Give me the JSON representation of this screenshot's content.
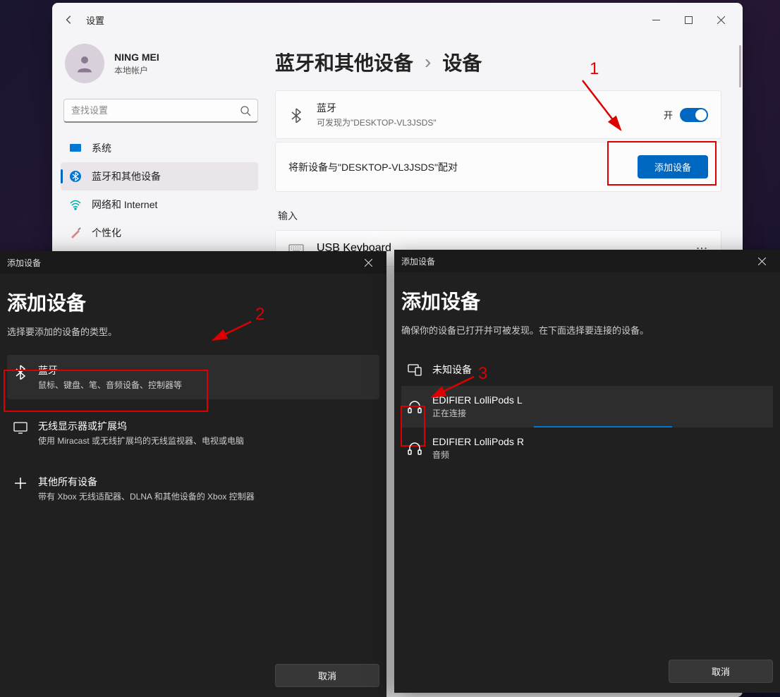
{
  "window": {
    "title": "设置",
    "profile_name": "NING MEI",
    "profile_sub": "本地帐户",
    "search_placeholder": "查找设置"
  },
  "nav": {
    "system": "系统",
    "bluetooth": "蓝牙和其他设备",
    "network": "网络和 Internet",
    "personalization": "个性化"
  },
  "breadcrumb": {
    "parent": "蓝牙和其他设备",
    "current": "设备"
  },
  "bluetooth_card": {
    "title": "蓝牙",
    "sub": "可发现为\"DESKTOP-VL3JSDS\"",
    "toggle_label": "开"
  },
  "pair_card": {
    "text": "将新设备与\"DESKTOP-VL3JSDS\"配对",
    "button": "添加设备"
  },
  "input_section": {
    "label": "输入",
    "device1": "USB Keyboard"
  },
  "annotations": {
    "num1": "1",
    "num2": "2",
    "num3": "3"
  },
  "dialog1": {
    "titlebar": "添加设备",
    "heading": "添加设备",
    "sub": "选择要添加的设备的类型。",
    "opt_bt_title": "蓝牙",
    "opt_bt_sub": "鼠标、键盘、笔、音频设备、控制器等",
    "opt_wd_title": "无线显示器或扩展坞",
    "opt_wd_sub": "使用 Miracast 或无线扩展坞的无线监视器、电视或电脑",
    "opt_other_title": "其他所有设备",
    "opt_other_sub": "带有 Xbox 无线适配器、DLNA 和其他设备的 Xbox 控制器",
    "cancel": "取消"
  },
  "dialog2": {
    "titlebar": "添加设备",
    "heading": "添加设备",
    "sub": "确保你的设备已打开并可被发现。在下面选择要连接的设备。",
    "unknown": "未知设备",
    "dev1_name": "EDIFIER LolliPods L",
    "dev1_status": "正在连接",
    "dev2_name": "EDIFIER LolliPods R",
    "dev2_status": "音频",
    "cancel": "取消"
  }
}
